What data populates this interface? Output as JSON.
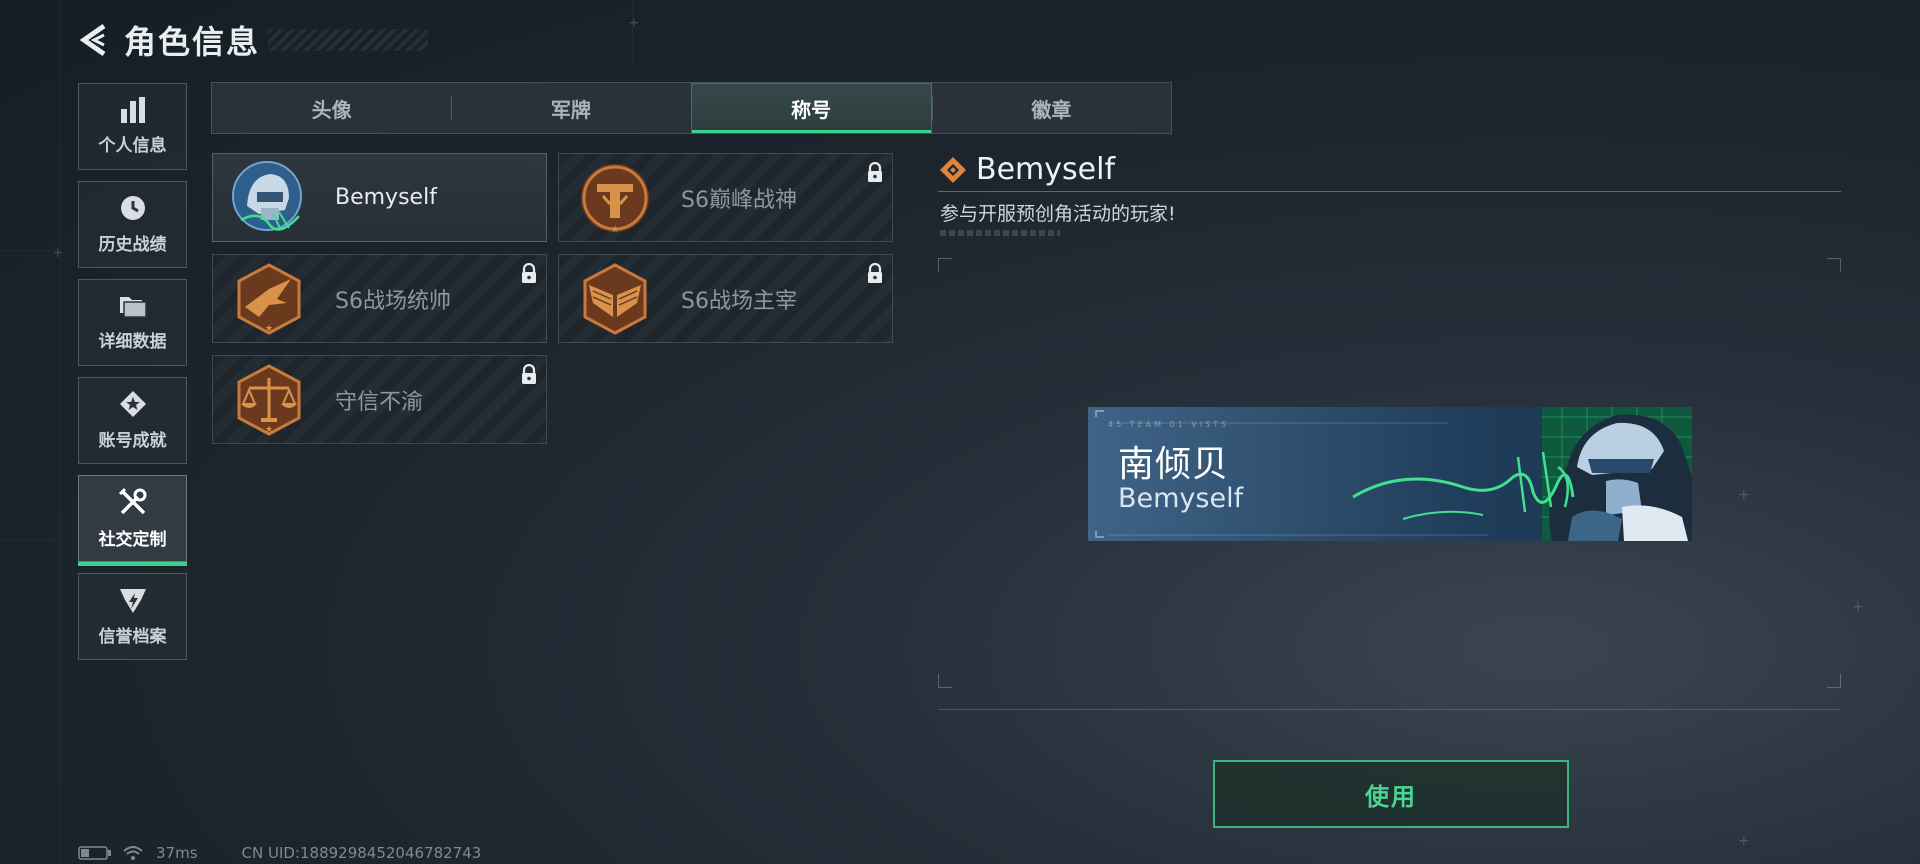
{
  "header": {
    "title": "角色信息",
    "back_icon": "chevron-left-icon"
  },
  "sidebar": {
    "items": [
      {
        "label": "个人信息",
        "icon": "bar-chart-icon"
      },
      {
        "label": "历史战绩",
        "icon": "clock-icon"
      },
      {
        "label": "详细数据",
        "icon": "folder-icon"
      },
      {
        "label": "账号成就",
        "icon": "achievement-icon"
      },
      {
        "label": "社交定制",
        "icon": "tools-icon",
        "active": true
      },
      {
        "label": "信誉档案",
        "icon": "shield-icon"
      }
    ]
  },
  "tabs": [
    {
      "label": "头像"
    },
    {
      "label": "军牌"
    },
    {
      "label": "称号",
      "active": true
    },
    {
      "label": "徽章"
    }
  ],
  "titles": [
    {
      "name": "Bemyself",
      "locked": false,
      "icon": "helmet-avatar-icon"
    },
    {
      "name": "S6巅峰战神",
      "locked": true,
      "icon": "t-emblem-icon"
    },
    {
      "name": "S6战场统帅",
      "locked": true,
      "icon": "jet-emblem-icon"
    },
    {
      "name": "S6战场主宰",
      "locked": true,
      "icon": "wings-emblem-icon"
    },
    {
      "name": "守信不渝",
      "locked": true,
      "icon": "scales-emblem-icon"
    }
  ],
  "detail": {
    "name": "Bemyself",
    "description": "参与开服预创角活动的玩家!",
    "badge_icon": "diamond-icon",
    "banner": {
      "name_cn": "南倾贝",
      "name_en": "Bemyself",
      "code": "45 TEAM 01 VISTS"
    }
  },
  "actions": {
    "use_label": "使用"
  },
  "status": {
    "ping": "37ms",
    "uid": "CN UID:1889298452046782743"
  },
  "colors": {
    "accent": "#3fd08a",
    "lock_orange": "#e0843a",
    "bronze": "#c9793a"
  }
}
